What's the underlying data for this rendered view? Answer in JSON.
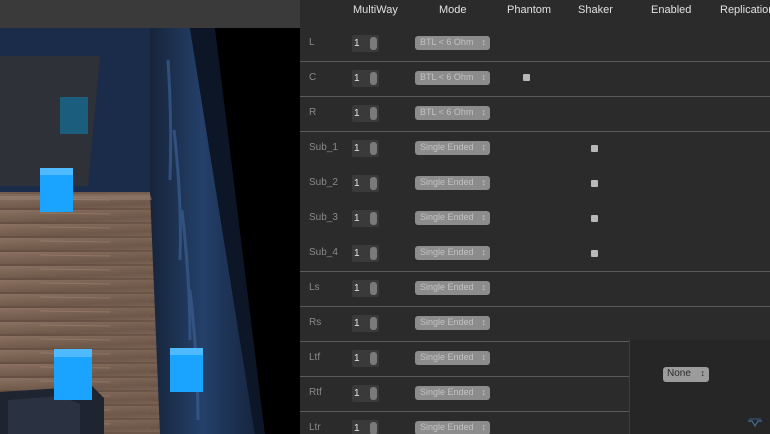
{
  "columns": [
    "MultiWay",
    "Mode",
    "Phantom",
    "Shaker",
    "Enabled",
    "Replication"
  ],
  "rows": [
    {
      "label": "L",
      "multiway": "1",
      "mode": "BTL < 6 Ohm",
      "phantom": false,
      "shaker": false
    },
    {
      "label": "C",
      "multiway": "1",
      "mode": "BTL < 6 Ohm",
      "phantom": true,
      "shaker": false
    },
    {
      "label": "R",
      "multiway": "1",
      "mode": "BTL < 6 Ohm",
      "phantom": false,
      "shaker": false
    },
    {
      "label": "Sub_1",
      "multiway": "1",
      "mode": "Single Ended",
      "phantom": false,
      "shaker": true
    },
    {
      "label": "Sub_2",
      "multiway": "1",
      "mode": "Single Ended",
      "phantom": false,
      "shaker": true
    },
    {
      "label": "Sub_3",
      "multiway": "1",
      "mode": "Single Ended",
      "phantom": false,
      "shaker": true
    },
    {
      "label": "Sub_4",
      "multiway": "1",
      "mode": "Single Ended",
      "phantom": false,
      "shaker": true
    },
    {
      "label": "Ls",
      "multiway": "1",
      "mode": "Single Ended",
      "phantom": false,
      "shaker": false
    },
    {
      "label": "Rs",
      "multiway": "1",
      "mode": "Single Ended",
      "phantom": false,
      "shaker": false
    },
    {
      "label": "Ltf",
      "multiway": "1",
      "mode": "Single Ended",
      "phantom": false,
      "shaker": false
    },
    {
      "label": "Rtf",
      "multiway": "1",
      "mode": "Single Ended",
      "phantom": false,
      "shaker": false
    },
    {
      "label": "Ltr",
      "multiway": "1",
      "mode": "Single Ended",
      "phantom": false,
      "shaker": false
    }
  ],
  "replication": {
    "value": "None"
  },
  "colors": {
    "speaker": "#1aa3ff",
    "wall": "#1b3050",
    "floor": "#7a6354",
    "panel": "#2b2b2b"
  },
  "icons": {
    "stepper": "up-down-arrows-icon",
    "select": "chevron-up-down-icon",
    "watermark": "logo-icon"
  }
}
